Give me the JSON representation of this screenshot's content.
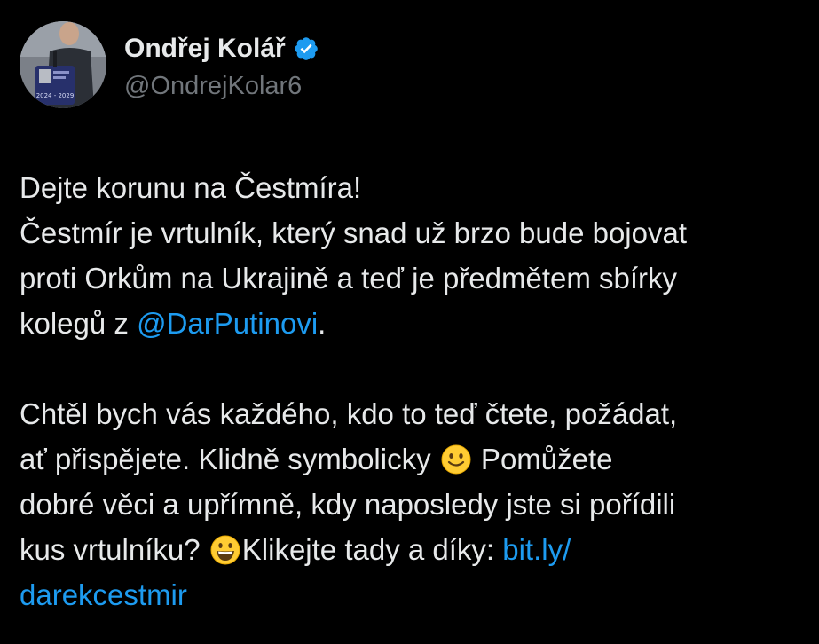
{
  "author": {
    "display_name": "Ondřej Kolář",
    "handle": "@OndrejKolar6",
    "verified_icon": "verified-badge-icon",
    "avatar_card_text": "2024 - 2029"
  },
  "tweet": {
    "line1": "Dejte korunu na Čestmíra!",
    "line2": "Čestmír je vrtulník, který snad už brzo bude bojovat",
    "line3": "proti Orkům na Ukrajině a teď je předmětem sbírky",
    "line4_pre": "kolegů z ",
    "mention": "@DarPutinovi",
    "line4_post": ".",
    "line5": "Chtěl bych vás každého, kdo to teď čtete, požádat,",
    "line6_pre": "ať přispějete. Klidně symbolicky",
    "line6_post": " Pomůžete",
    "line7": "dobré věci a upřímně, kdy naposledy jste si pořídili",
    "line8_pre": "kus vrtulníku?",
    "line8_mid": "Klikejte tady a díky: ",
    "link_part1": "bit.ly/",
    "link_part2": "darekcestmir",
    "emoji_1": "slightly-smiling-face-icon",
    "emoji_2": "grinning-face-icon"
  },
  "colors": {
    "background": "#000000",
    "text": "#e7e9ea",
    "secondary": "#71767b",
    "link": "#1d9bf0"
  }
}
